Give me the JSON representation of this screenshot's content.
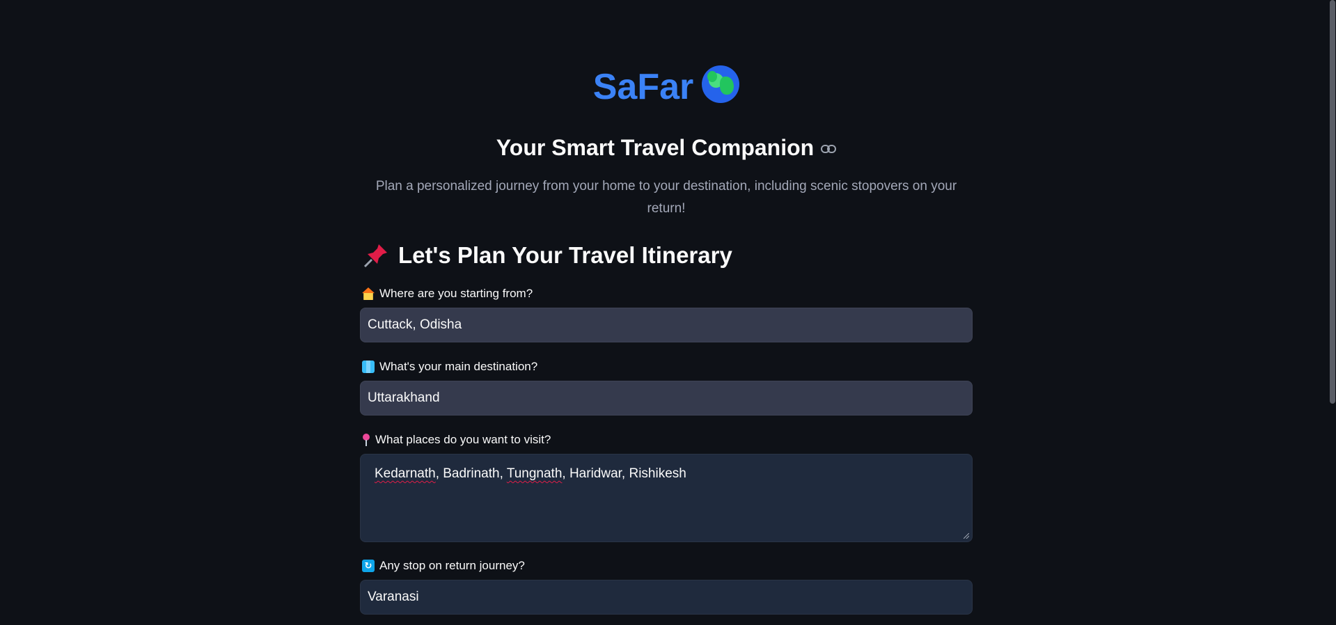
{
  "header": {
    "app_title": "SaFar",
    "globe_icon": "globe-icon",
    "subtitle": "Your Smart Travel Companion",
    "description_line1": "Plan a personalized journey from your home to your destination, including scenic stopovers on your",
    "description_line2": "return!"
  },
  "form": {
    "heading": "Let's Plan Your Travel Itinerary",
    "start": {
      "label": "Where are you starting from?",
      "value": "Cuttack, Odisha"
    },
    "destination": {
      "label": "What's your main destination?",
      "value": "Uttarakhand"
    },
    "places": {
      "label": "What places do you want to visit?",
      "value_parts": [
        "Kedarnath",
        ", ",
        "Badrinath",
        ", ",
        "Tungnath",
        ", Haridwar, Rishikesh"
      ]
    },
    "return_stop": {
      "label": "Any stop on return journey?",
      "value": "Varanasi"
    }
  },
  "colors": {
    "background": "#0e1117",
    "title_blue": "#3b82f6",
    "input_bg": "#353a4d",
    "textarea_bg": "#1f2a3d"
  }
}
